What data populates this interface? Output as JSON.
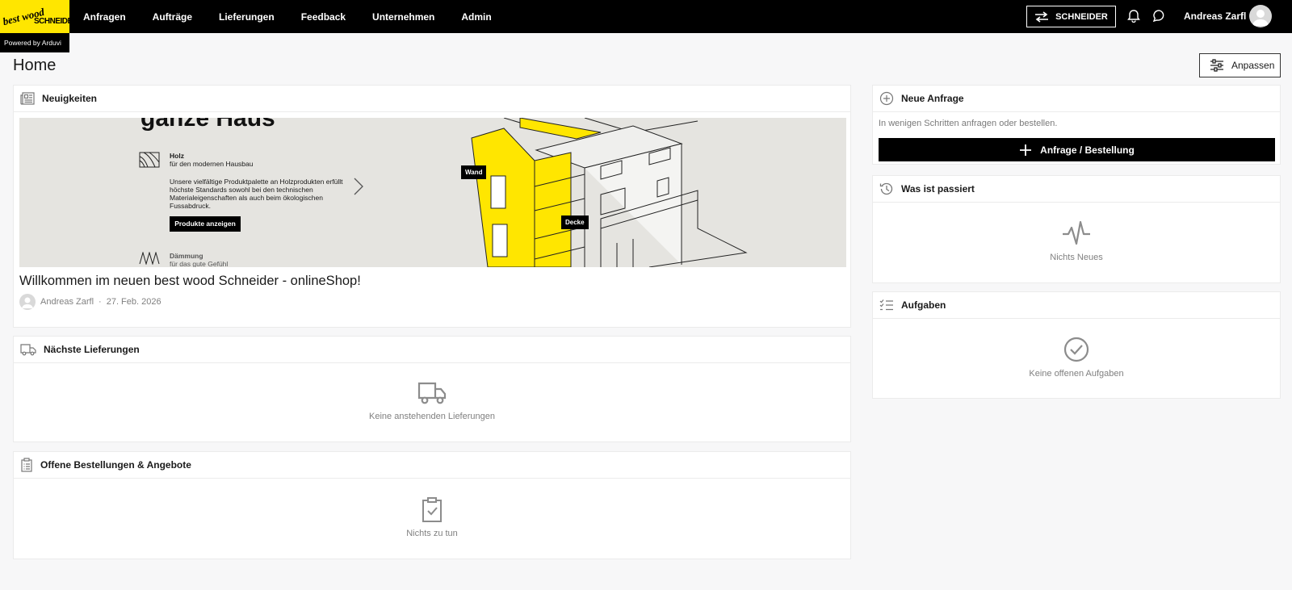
{
  "logo": {
    "line1": "best wood",
    "line2": "SCHNEIDER",
    "powered": "Powered by Arduvi"
  },
  "nav": {
    "items": [
      "Anfragen",
      "Aufträge",
      "Lieferungen",
      "Feedback",
      "Unternehmen",
      "Admin"
    ]
  },
  "header": {
    "switch_label": "SCHNEIDER",
    "user_name": "Andreas Zarfl"
  },
  "page": {
    "title": "Home",
    "customize_label": "Anpassen"
  },
  "news": {
    "heading": "Neuigkeiten",
    "banner": {
      "headline": "ganze Haus",
      "holz_title": "Holz",
      "holz_sub": "für den modernen Hausbau",
      "body_line1": "Unsere vielfältige Produktpalette an Holzprodukten erfüllt",
      "body_line2": "höchste Standards sowohl bei den technischen",
      "body_line3": "Materialeigenschaften als auch beim ökologischen",
      "body_line4": "Fussabdruck.",
      "button": "Produkte anzeigen",
      "daemmung_title": "Dämmung",
      "daemmung_sub": "für das gute Gefühl",
      "tag_wand": "Wand",
      "tag_decke": "Decke"
    },
    "title": "Willkommen im neuen best wood Schneider - onlineShop!",
    "author": "Andreas Zarfl",
    "separator": "·",
    "date": "27. Feb. 2026"
  },
  "deliveries": {
    "heading": "Nächste Lieferungen",
    "empty": "Keine anstehenden Lieferungen"
  },
  "orders": {
    "heading": "Offene Bestellungen & Angebote",
    "empty": "Nichts zu tun"
  },
  "new_request": {
    "heading": "Neue Anfrage",
    "description": "In wenigen Schritten anfragen oder bestellen.",
    "button": "Anfrage / Bestellung"
  },
  "activity": {
    "heading": "Was ist passiert",
    "empty": "Nichts Neues"
  },
  "tasks": {
    "heading": "Aufgaben",
    "empty": "Keine offenen Aufgaben"
  },
  "colors": {
    "brand_yellow": "#ffe600",
    "header_bg": "#000000",
    "icon_gray": "#8c8c8c"
  }
}
